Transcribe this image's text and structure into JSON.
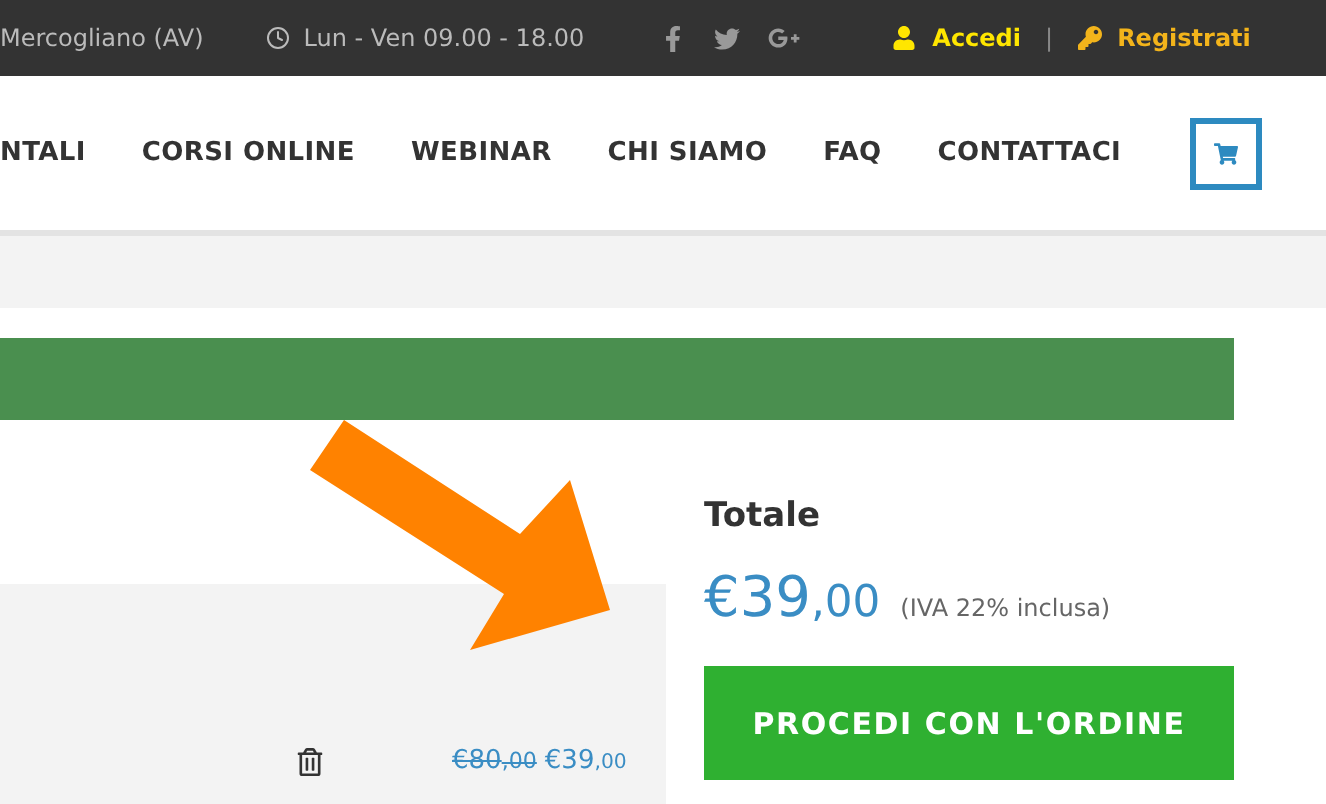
{
  "top_bar": {
    "address": "Mercogliano (AV)",
    "hours": "Lun - Ven 09.00 - 18.00",
    "social": [
      {
        "kind": "facebook"
      },
      {
        "kind": "twitter"
      },
      {
        "kind": "googleplus"
      }
    ],
    "login": "Accedi",
    "separator": "|",
    "register": "Registrati"
  },
  "nav": {
    "items": [
      {
        "label": "NTALI"
      },
      {
        "label": "CORSI ONLINE"
      },
      {
        "label": "WEBINAR"
      },
      {
        "label": "CHI SIAMO"
      },
      {
        "label": "FAQ"
      },
      {
        "label": "CONTATTACI"
      }
    ]
  },
  "cart_item": {
    "old_price": {
      "main": "€80",
      "cents": ",00"
    },
    "price": {
      "main": "€39",
      "cents": ",00"
    }
  },
  "summary": {
    "title": "Totale",
    "total": {
      "main": "€39",
      "cents": ",00"
    },
    "tax_note": "(IVA 22% inclusa)",
    "checkout_button": "PROCEDI CON L'ORDINE"
  }
}
